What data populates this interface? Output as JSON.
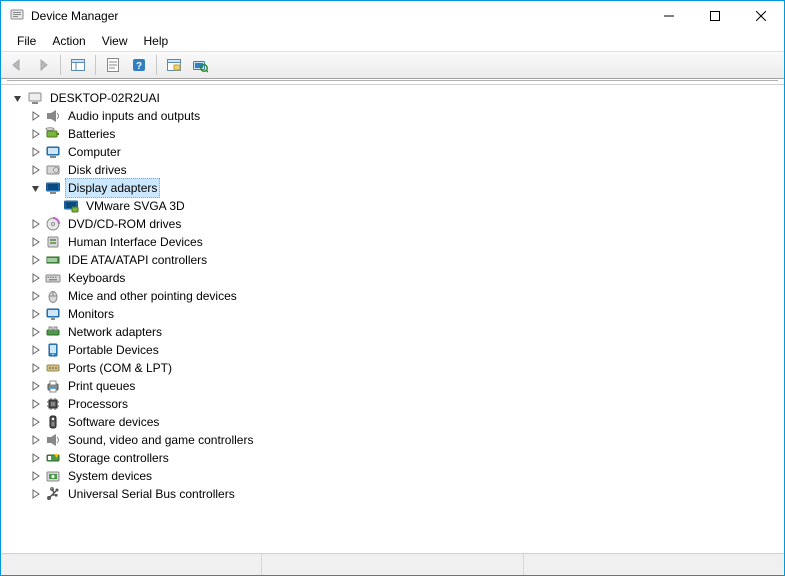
{
  "window": {
    "title": "Device Manager"
  },
  "menubar": [
    "File",
    "Action",
    "View",
    "Help"
  ],
  "toolbar_buttons": [
    "back",
    "forward",
    "|",
    "show-hide-tree",
    "properties",
    "help",
    "update",
    "scan-hardware"
  ],
  "tree": {
    "root": {
      "label": "DESKTOP-02R2UAI",
      "expanded": true,
      "icon": "computer-root",
      "children": [
        {
          "label": "Audio inputs and outputs",
          "icon": "audio",
          "expandable": true
        },
        {
          "label": "Batteries",
          "icon": "battery",
          "expandable": true
        },
        {
          "label": "Computer",
          "icon": "computer",
          "expandable": true
        },
        {
          "label": "Disk drives",
          "icon": "disk",
          "expandable": true
        },
        {
          "label": "Display adapters",
          "icon": "display",
          "expandable": true,
          "expanded": true,
          "selected": true,
          "children": [
            {
              "label": "VMware SVGA 3D",
              "icon": "display-leaf"
            }
          ]
        },
        {
          "label": "DVD/CD-ROM drives",
          "icon": "dvd",
          "expandable": true
        },
        {
          "label": "Human Interface Devices",
          "icon": "hid",
          "expandable": true
        },
        {
          "label": "IDE ATA/ATAPI controllers",
          "icon": "ide",
          "expandable": true
        },
        {
          "label": "Keyboards",
          "icon": "keyboard",
          "expandable": true
        },
        {
          "label": "Mice and other pointing devices",
          "icon": "mouse",
          "expandable": true
        },
        {
          "label": "Monitors",
          "icon": "monitor",
          "expandable": true
        },
        {
          "label": "Network adapters",
          "icon": "network",
          "expandable": true
        },
        {
          "label": "Portable Devices",
          "icon": "portable",
          "expandable": true
        },
        {
          "label": "Ports (COM & LPT)",
          "icon": "port",
          "expandable": true
        },
        {
          "label": "Print queues",
          "icon": "printer",
          "expandable": true
        },
        {
          "label": "Processors",
          "icon": "cpu",
          "expandable": true
        },
        {
          "label": "Software devices",
          "icon": "software",
          "expandable": true
        },
        {
          "label": "Sound, video and game controllers",
          "icon": "sound",
          "expandable": true
        },
        {
          "label": "Storage controllers",
          "icon": "storage",
          "expandable": true
        },
        {
          "label": "System devices",
          "icon": "system",
          "expandable": true
        },
        {
          "label": "Universal Serial Bus controllers",
          "icon": "usb",
          "expandable": true
        }
      ]
    }
  }
}
